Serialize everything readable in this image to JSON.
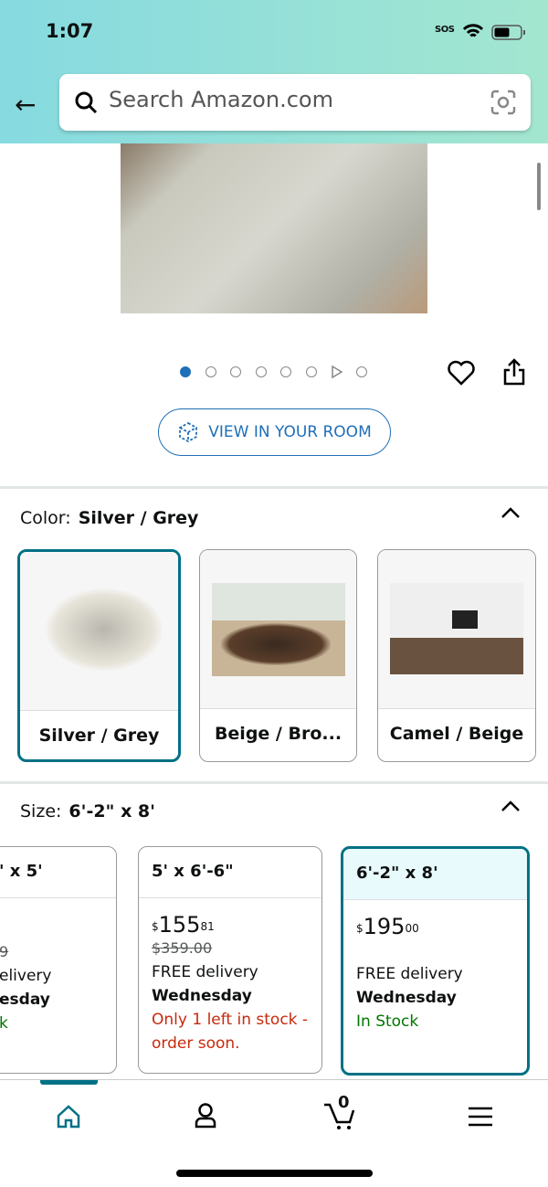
{
  "status_bar": {
    "time": "1:07",
    "sos": "SOS"
  },
  "header": {
    "search_placeholder": "Search Amazon.com"
  },
  "gallery": {
    "dot_count": 8,
    "active_index": 0,
    "view_in_room": "VIEW IN YOUR ROOM"
  },
  "color": {
    "label": "Color:",
    "selected": "Silver / Grey",
    "options": [
      {
        "label": "Silver / Grey",
        "selected": true
      },
      {
        "label": "Beige / Bro...",
        "selected": false
      },
      {
        "label": "Camel / Beige",
        "selected": false
      }
    ]
  },
  "size": {
    "label": "Size:",
    "selected": "6'-2\" x 8'",
    "options": [
      {
        "title": "' x 5'",
        "price_whole": "",
        "price_frac": "",
        "list_price": "9",
        "delivery": "elivery",
        "day": "esday",
        "stock": "k",
        "stock_color": "green"
      },
      {
        "title": "5' x 6'-6\"",
        "price_symbol": "$",
        "price_whole": "155",
        "price_frac": "81",
        "list_price": "$359.00",
        "delivery": "FREE delivery",
        "day": "Wednesday",
        "stock": "Only 1 left in stock - order soon.",
        "stock_color": "red"
      },
      {
        "title": "6'-2\" x 8'",
        "price_symbol": "$",
        "price_whole": "195",
        "price_frac": "00",
        "list_price": "",
        "delivery": "FREE delivery",
        "day": "Wednesday",
        "stock": "In Stock",
        "stock_color": "green"
      }
    ]
  },
  "nav": {
    "cart_count": "0",
    "active": "home"
  },
  "colors": {
    "accent": "#007185",
    "link": "#1f6fb8",
    "red": "#c7290d",
    "green": "#007600"
  }
}
